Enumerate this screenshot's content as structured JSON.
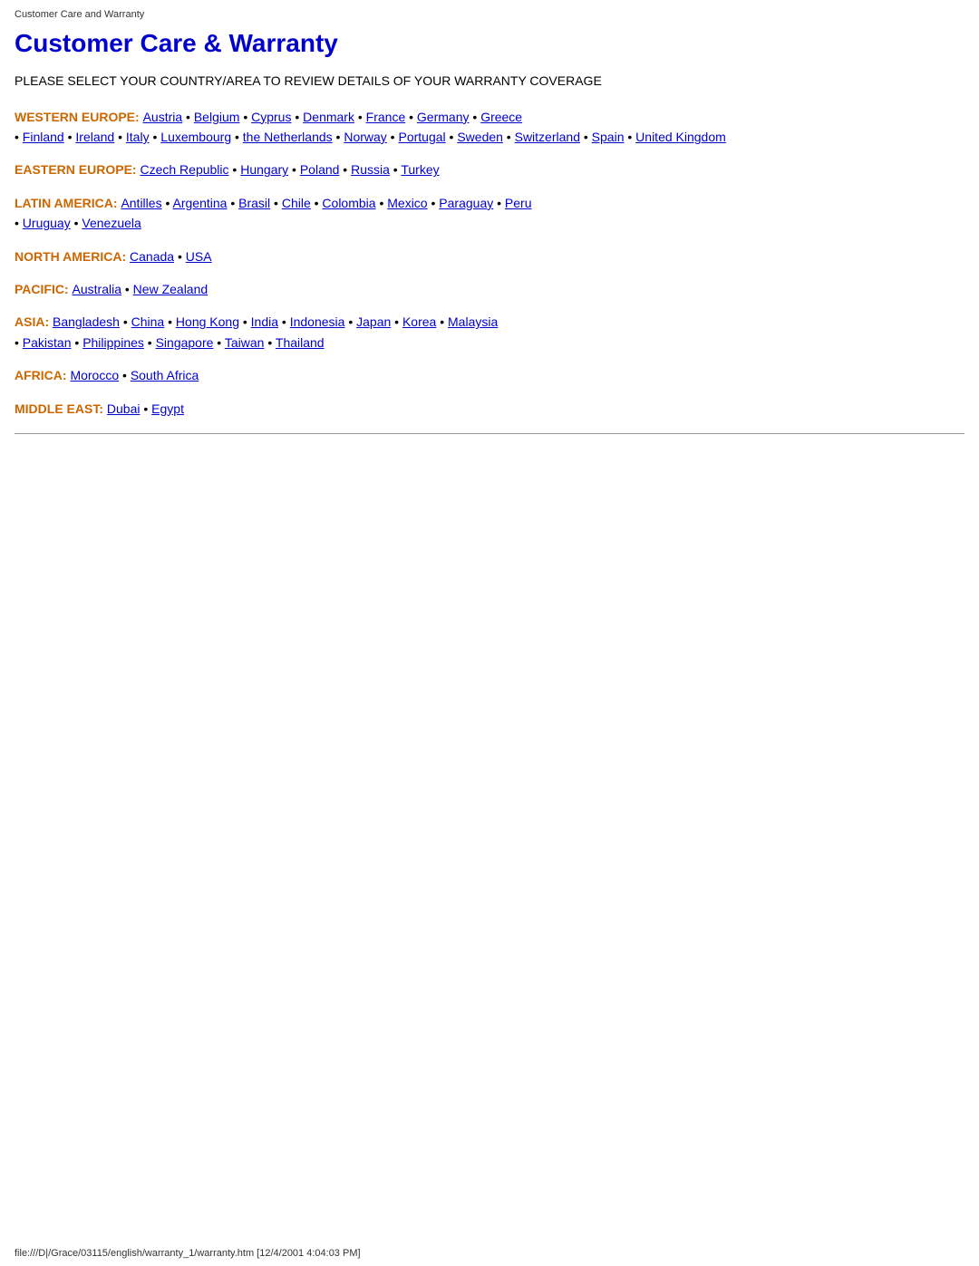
{
  "browser_tab": "Customer Care and Warranty",
  "page_title": "Customer Care & Warranty",
  "subtitle": "PLEASE SELECT YOUR COUNTRY/AREA TO REVIEW DETAILS OF YOUR WARRANTY COVERAGE",
  "regions": [
    {
      "id": "western-europe",
      "label": "WESTERN EUROPE:",
      "countries": [
        {
          "name": "Austria",
          "href": "#"
        },
        {
          "name": "Belgium",
          "href": "#"
        },
        {
          "name": "Cyprus",
          "href": "#"
        },
        {
          "name": "Denmark",
          "href": "#"
        },
        {
          "name": "France",
          "href": "#"
        },
        {
          "name": "Germany",
          "href": "#"
        },
        {
          "name": "Greece",
          "href": "#"
        },
        {
          "name": "Finland",
          "href": "#"
        },
        {
          "name": "Ireland",
          "href": "#"
        },
        {
          "name": "Italy",
          "href": "#"
        },
        {
          "name": "Luxembourg",
          "href": "#"
        },
        {
          "name": "the Netherlands",
          "href": "#"
        },
        {
          "name": "Norway",
          "href": "#"
        },
        {
          "name": "Portugal",
          "href": "#"
        },
        {
          "name": "Sweden",
          "href": "#"
        },
        {
          "name": "Switzerland",
          "href": "#"
        },
        {
          "name": "Spain",
          "href": "#"
        },
        {
          "name": "United Kingdom",
          "href": "#"
        }
      ]
    },
    {
      "id": "eastern-europe",
      "label": "EASTERN EUROPE:",
      "countries": [
        {
          "name": "Czech Republic",
          "href": "#"
        },
        {
          "name": "Hungary",
          "href": "#"
        },
        {
          "name": "Poland",
          "href": "#"
        },
        {
          "name": "Russia",
          "href": "#"
        },
        {
          "name": "Turkey",
          "href": "#"
        }
      ]
    },
    {
      "id": "latin-america",
      "label": "LATIN AMERICA:",
      "countries": [
        {
          "name": "Antilles",
          "href": "#"
        },
        {
          "name": "Argentina",
          "href": "#"
        },
        {
          "name": "Brasil",
          "href": "#"
        },
        {
          "name": "Chile",
          "href": "#"
        },
        {
          "name": "Colombia",
          "href": "#"
        },
        {
          "name": "Mexico",
          "href": "#"
        },
        {
          "name": "Paraguay",
          "href": "#"
        },
        {
          "name": "Peru",
          "href": "#"
        },
        {
          "name": "Uruguay",
          "href": "#"
        },
        {
          "name": "Venezuela",
          "href": "#"
        }
      ]
    },
    {
      "id": "north-america",
      "label": "NORTH AMERICA:",
      "countries": [
        {
          "name": "Canada",
          "href": "#"
        },
        {
          "name": "USA",
          "href": "#"
        }
      ]
    },
    {
      "id": "pacific",
      "label": "PACIFIC:",
      "countries": [
        {
          "name": "Australia",
          "href": "#"
        },
        {
          "name": "New Zealand",
          "href": "#"
        }
      ]
    },
    {
      "id": "asia",
      "label": "ASIA:",
      "countries": [
        {
          "name": "Bangladesh",
          "href": "#"
        },
        {
          "name": "China",
          "href": "#"
        },
        {
          "name": "Hong Kong",
          "href": "#"
        },
        {
          "name": "India",
          "href": "#"
        },
        {
          "name": "Indonesia",
          "href": "#"
        },
        {
          "name": "Japan",
          "href": "#"
        },
        {
          "name": "Korea",
          "href": "#"
        },
        {
          "name": "Malaysia",
          "href": "#"
        },
        {
          "name": "Pakistan",
          "href": "#"
        },
        {
          "name": "Philippines",
          "href": "#"
        },
        {
          "name": "Singapore",
          "href": "#"
        },
        {
          "name": "Taiwan",
          "href": "#"
        },
        {
          "name": "Thailand",
          "href": "#"
        }
      ]
    },
    {
      "id": "africa",
      "label": "AFRICA:",
      "countries": [
        {
          "name": "Morocco",
          "href": "#"
        },
        {
          "name": "South Africa",
          "href": "#"
        }
      ]
    },
    {
      "id": "middle-east",
      "label": "MIDDLE EAST:",
      "countries": [
        {
          "name": "Dubai",
          "href": "#"
        },
        {
          "name": "Egypt",
          "href": "#"
        }
      ]
    }
  ],
  "footer_text": "file:///D|/Grace/03115/english/warranty_1/warranty.htm [12/4/2001 4:04:03 PM]"
}
